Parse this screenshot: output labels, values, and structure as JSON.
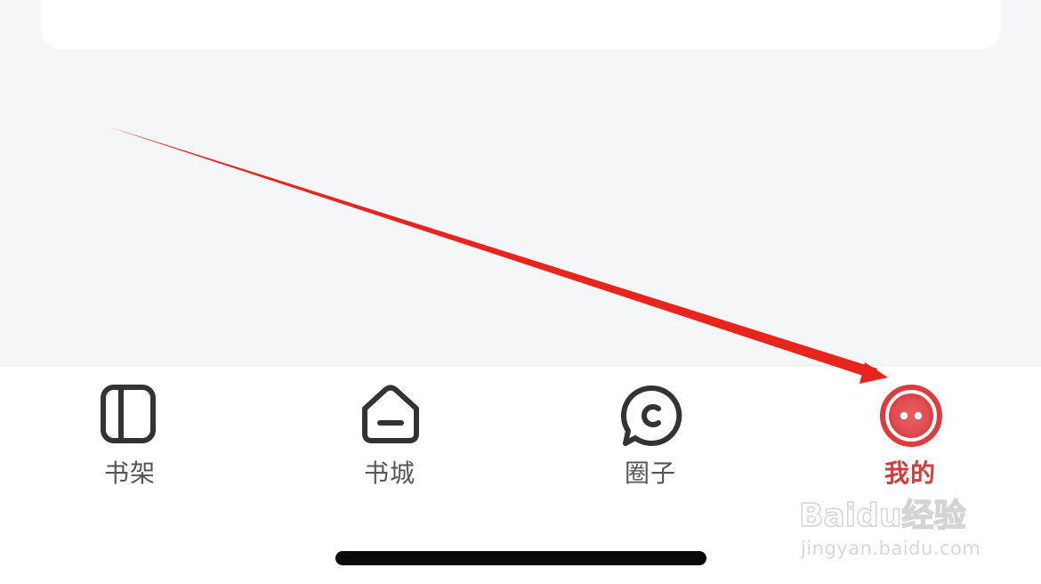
{
  "tabbar": {
    "items": [
      {
        "id": "bookshelf",
        "label": "书架",
        "icon": "bookshelf-icon",
        "active": false
      },
      {
        "id": "bookstore",
        "label": "书城",
        "icon": "bookstore-icon",
        "active": false
      },
      {
        "id": "circle",
        "label": "圈子",
        "icon": "chat-bubble-icon",
        "active": false
      },
      {
        "id": "mine",
        "label": "我的",
        "icon": "profile-face-icon",
        "active": true
      }
    ]
  },
  "watermark": {
    "logo_text": "Baidu经验",
    "url": "jingyan.baidu.com"
  },
  "colors": {
    "background": "#f5f6f8",
    "tabbar_bg": "#ffffff",
    "icon_inactive": "#333333",
    "label_inactive": "#555555",
    "accent": "#d23c3c",
    "annotation_arrow": "#e8251c",
    "home_indicator": "#0a0a0a"
  }
}
